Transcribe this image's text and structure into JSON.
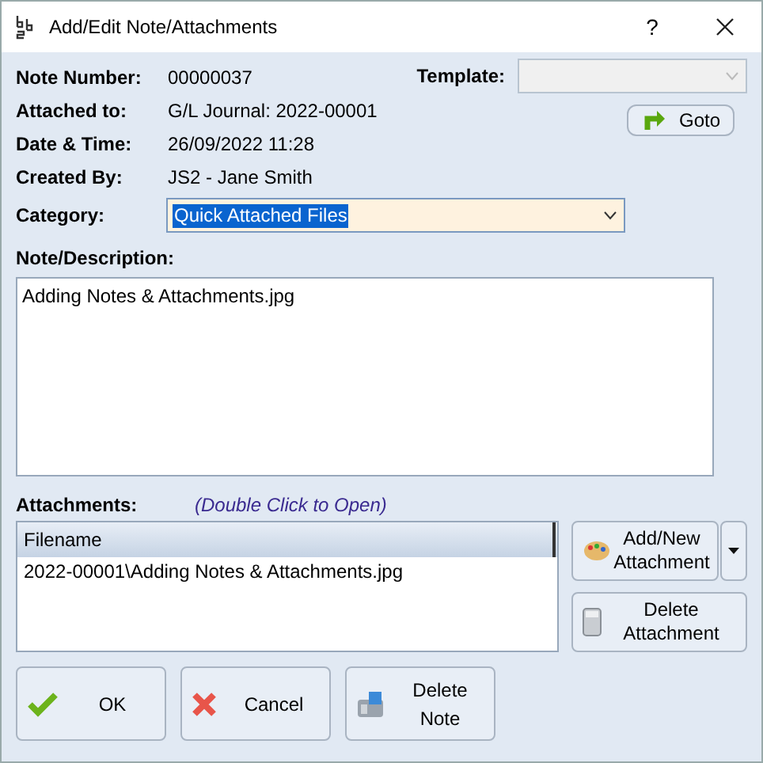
{
  "window": {
    "title": "Add/Edit Note/Attachments",
    "buttons": [
      "?"
    ]
  },
  "fields": [
    {
      "label": "Note Number:",
      "value": "00000037"
    },
    {
      "label": "Attached to:",
      "value": "G/L Journal: 2022-00001"
    },
    {
      "label": "Date & Time:",
      "value": "26/09/2022 11:28"
    },
    {
      "label": "Created By:",
      "value": "JS2 - Jane Smith"
    }
  ],
  "template": {
    "label": "Template:",
    "disabled": true
  },
  "goto_button": "Goto",
  "category": {
    "label": "Category:",
    "value": "Quick Attached Files"
  },
  "note": {
    "label": "Note/Description:",
    "value": "Adding Notes & Attachments.jpg"
  },
  "attachments": {
    "label": "Attachments:",
    "hint": "(Double Click to Open)",
    "columns": [
      "Filename"
    ],
    "rows": [
      "2022-00001\\Adding Notes & Attachments.jpg"
    ]
  },
  "side_buttons": [
    {
      "label": "Add/New Attachment",
      "kind": "add"
    },
    {
      "label": "Delete Attachment",
      "kind": "delete"
    }
  ],
  "buttons": [
    {
      "label": "OK",
      "kind": "ok"
    },
    {
      "label": "Cancel",
      "kind": "cancel"
    },
    {
      "label": "Delete Note",
      "kind": "delete-note"
    }
  ]
}
